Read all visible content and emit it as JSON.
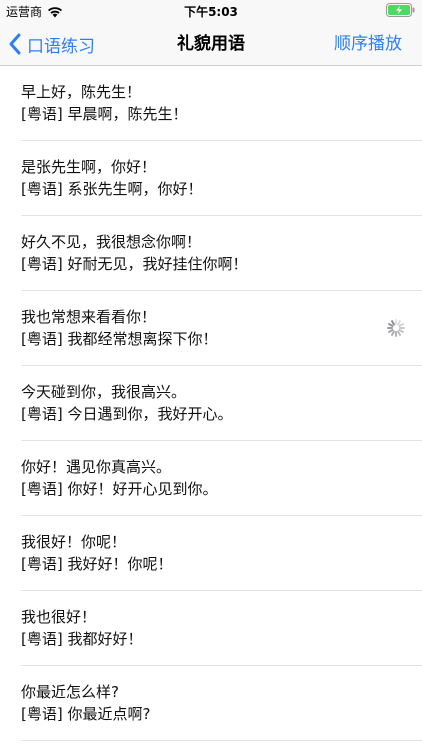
{
  "status_bar": {
    "carrier": "运营商",
    "time": "下午5:03"
  },
  "nav": {
    "back_label": "口语练习",
    "title": "礼貌用语",
    "play_label": "顺序播放"
  },
  "colors": {
    "accent": "#2d7ff9",
    "battery": "#4cd964"
  },
  "phrases": [
    {
      "mandarin": "早上好，陈先生！",
      "cantonese": "[粤语] 早晨啊，陈先生！"
    },
    {
      "mandarin": "是张先生啊，你好！",
      "cantonese": "[粤语] 系张先生啊，你好！"
    },
    {
      "mandarin": "好久不见，我很想念你啊！",
      "cantonese": "[粤语] 好耐无见，我好挂住你啊！"
    },
    {
      "mandarin": "我也常想来看看你！",
      "cantonese": "[粤语] 我都经常想离探下你！",
      "loading": true
    },
    {
      "mandarin": "今天碰到你，我很高兴。",
      "cantonese": "[粤语] 今日遇到你，我好开心。"
    },
    {
      "mandarin": "你好！遇见你真高兴。",
      "cantonese": "[粤语] 你好！好开心见到你。"
    },
    {
      "mandarin": "我很好！你呢！",
      "cantonese": "[粤语] 我好好！你呢！"
    },
    {
      "mandarin": "我也很好！",
      "cantonese": "[粤语] 我都好好！"
    },
    {
      "mandarin": "你最近怎么样?",
      "cantonese": "[粤语] 你最近点啊?"
    }
  ]
}
